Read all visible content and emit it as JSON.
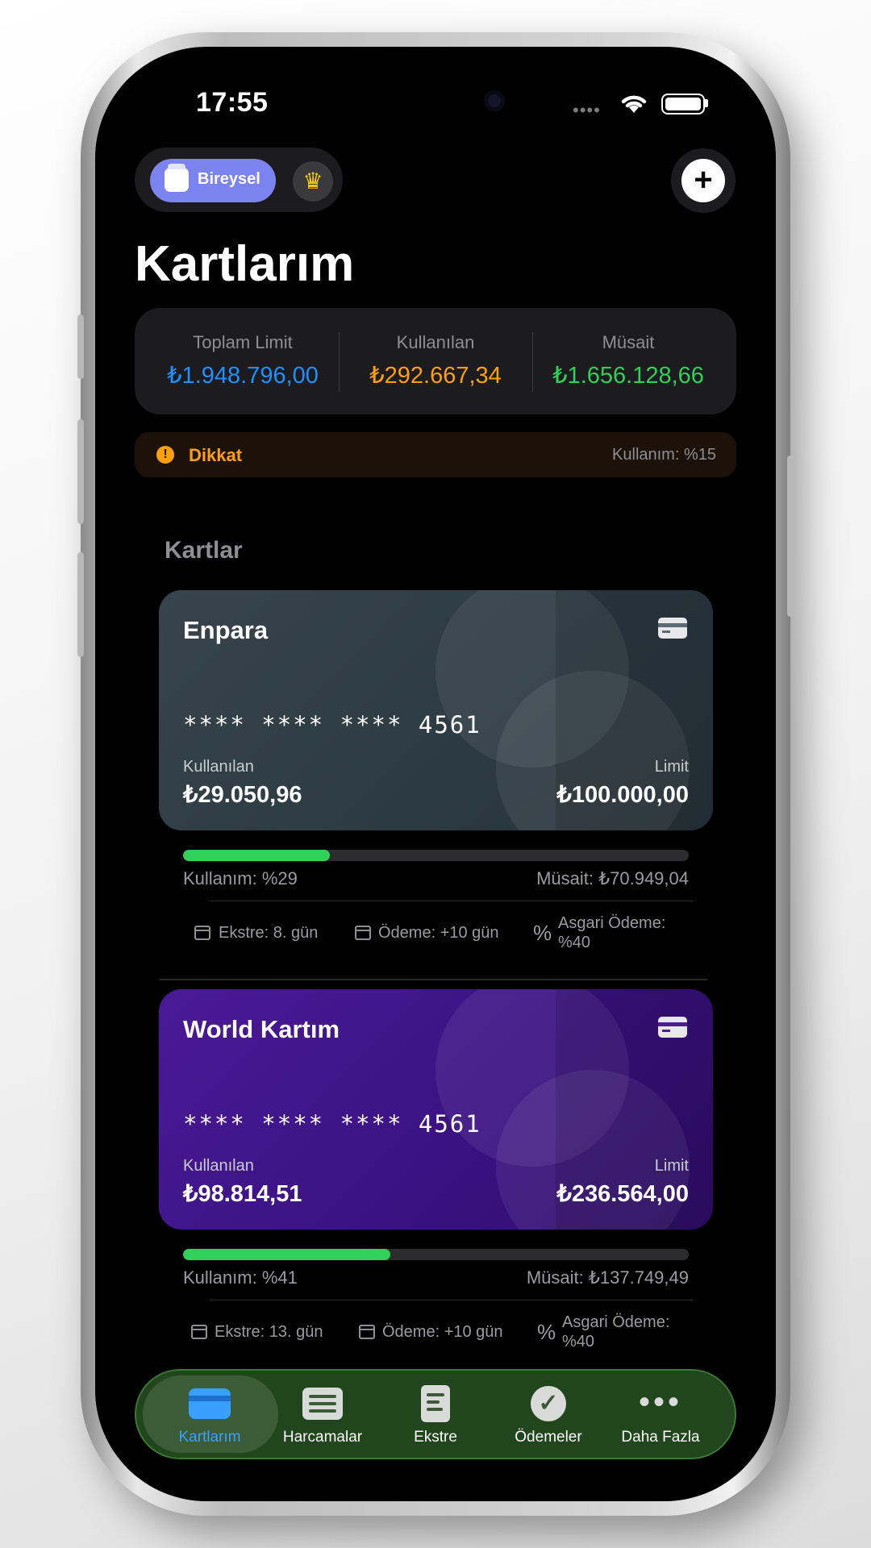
{
  "status_bar": {
    "time": "17:55"
  },
  "top": {
    "segment_label": "Bireysel"
  },
  "page_title": "Kartlarım",
  "summary": {
    "total_label": "Toplam Limit",
    "total_value": "₺1.948.796,00",
    "total_color": "#1e90ff",
    "used_label": "Kullanılan",
    "used_value": "₺292.667,34",
    "used_color": "#ff9f0a",
    "available_label": "Müsait",
    "available_value": "₺1.656.128,66",
    "available_color": "#30d158"
  },
  "warning": {
    "title": "Dikkat",
    "usage": "Kullanım: %15",
    "icon": "!"
  },
  "section_title": "Kartlar",
  "cards": [
    {
      "name": "Enpara",
      "number": "**** **** **** 4561",
      "used_label": "Kullanılan",
      "used": "₺29.050,96",
      "limit_label": "Limit",
      "limit": "₺100.000,00",
      "usage_percent": 29,
      "usage_text": "Kullanım: %29",
      "available_text": "Müsait: ₺70.949,04",
      "statement": "Ekstre: 8. gün",
      "payment": "Ödeme: +10 gün",
      "min_payment_line1": "Asgari Ödeme:",
      "min_payment_line2": "%40"
    },
    {
      "name": "World Kartım",
      "number": "**** **** **** 4561",
      "used_label": "Kullanılan",
      "used": "₺98.814,51",
      "limit_label": "Limit",
      "limit": "₺236.564,00",
      "usage_percent": 41,
      "usage_text": "Kullanım: %41",
      "available_text": "Müsait: ₺137.749,49",
      "statement": "Ekstre: 13. gün",
      "payment": "Ödeme: +10 gün",
      "min_payment_line1": "Asgari Ödeme:",
      "min_payment_line2": "%40"
    }
  ],
  "tabs": [
    {
      "label": "Kartlarım",
      "icon": "credit-card-icon",
      "active": true
    },
    {
      "label": "Harcamalar",
      "icon": "list-icon",
      "active": false
    },
    {
      "label": "Ekstre",
      "icon": "document-icon",
      "active": false
    },
    {
      "label": "Ödemeler",
      "icon": "checkmark-circle-icon",
      "active": false
    },
    {
      "label": "Daha Fazla",
      "icon": "more-icon",
      "active": false
    }
  ],
  "colors": {
    "accent_blue": "#3aa0ff",
    "progress_green": "#30d158",
    "segment_active": "#7b83f0",
    "card1_bg": "#2f3d45",
    "card2_bg": "#3b1283",
    "tabbar_bg": "#285523"
  }
}
